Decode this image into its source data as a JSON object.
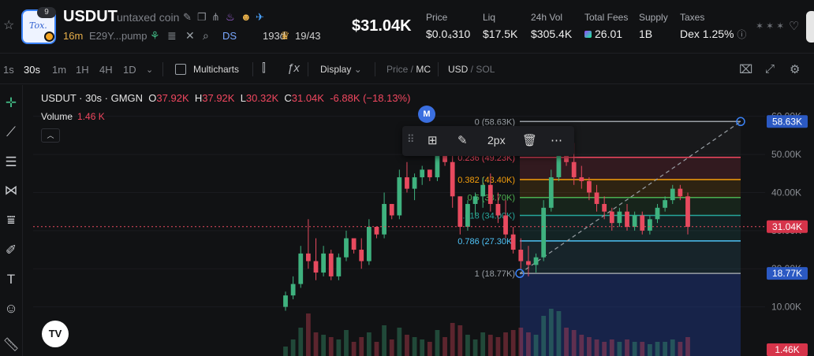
{
  "header": {
    "token_symbol": "USDUT",
    "token_name": "untaxed coin",
    "logo_text": "Tox.",
    "logo_badge": "9",
    "age": "16m",
    "address": "E29Y...pump",
    "ds_label": "DS",
    "ds_value": "193d",
    "holders": "19/43",
    "price": "$31.04K",
    "stats": [
      {
        "label": "Price",
        "value": "$0.0₄310"
      },
      {
        "label": "Liq",
        "value": "$17.5K"
      },
      {
        "label": "24h Vol",
        "value": "$305.4K"
      },
      {
        "label": "Total Fees",
        "value": "26.01"
      },
      {
        "label": "Supply",
        "value": "1B"
      },
      {
        "label": "Taxes",
        "value": "Dex 1.25%"
      }
    ]
  },
  "toolbar": {
    "timeframes": [
      "1s",
      "30s",
      "1m",
      "1H",
      "4H",
      "1D"
    ],
    "active_timeframe": "30s",
    "multicharts": "Multicharts",
    "display": "Display",
    "price_label": "Price",
    "mc_label": "MC",
    "usd_label": "USD",
    "sol_label": "SOL"
  },
  "legend": {
    "title": "USDUT · 30s · GMGN",
    "o_label": "O",
    "o_value": "37.92K",
    "h_label": "H",
    "h_value": "37.92K",
    "l_label": "L",
    "l_value": "30.32K",
    "c_label": "C",
    "c_value": "31.04K",
    "change": "-6.88K (−18.13%)",
    "volume_label": "Volume",
    "volume_value": "1.46 K"
  },
  "float_bar": {
    "width_label": "2px"
  },
  "marker": "M",
  "chart_data": {
    "type": "candlestick",
    "price_axis_ticks": [
      "60.00K",
      "50.00K",
      "40.00K",
      "30.00K",
      "20.00K",
      "10.00K"
    ],
    "current_price_tag": "31.04K",
    "top_tag": "58.63K",
    "bottom_tag": "18.77K",
    "volume_tag": "1.46K",
    "fib_levels": [
      {
        "label": "0 (58.63K)",
        "ratio": 0,
        "price": 58.63,
        "color": "#9aa0a6"
      },
      {
        "label": "0.236 (49.23K)",
        "ratio": 0.236,
        "price": 49.23,
        "color": "#f0475f"
      },
      {
        "label": "0.382 (43.40K)",
        "ratio": 0.382,
        "price": 43.4,
        "color": "#f59e0b"
      },
      {
        "label": "0.5 (38.70K)",
        "ratio": 0.5,
        "price": 38.7,
        "color": "#4caf50"
      },
      {
        "label": "0.618 (34.00K)",
        "ratio": 0.618,
        "price": 34.0,
        "color": "#26a69a"
      },
      {
        "label": "0.786 (27.30K)",
        "ratio": 0.786,
        "price": 27.3,
        "color": "#4fc3f7"
      },
      {
        "label": "1 (18.77K)",
        "ratio": 1,
        "price": 18.77,
        "color": "#9aa0a6"
      }
    ],
    "candles": [
      [
        10,
        14,
        9,
        13
      ],
      [
        13,
        18,
        12,
        16
      ],
      [
        16,
        26,
        15,
        24
      ],
      [
        24,
        33,
        20,
        22
      ],
      [
        22,
        28,
        17,
        19
      ],
      [
        19,
        26,
        18,
        24
      ],
      [
        24,
        25,
        17,
        18
      ],
      [
        18,
        24,
        17,
        23
      ],
      [
        23,
        30,
        22,
        28
      ],
      [
        28,
        27,
        24,
        25
      ],
      [
        25,
        28,
        20,
        22
      ],
      [
        22,
        33,
        21,
        31
      ],
      [
        31,
        29,
        28,
        29
      ],
      [
        29,
        40,
        28,
        37
      ],
      [
        37,
        36,
        33,
        34
      ],
      [
        34,
        46,
        33,
        44
      ],
      [
        44,
        48,
        40,
        41
      ],
      [
        41,
        45,
        38,
        44
      ],
      [
        44,
        47,
        42,
        46
      ],
      [
        46,
        44,
        43,
        44
      ],
      [
        44,
        52,
        43,
        50
      ],
      [
        50,
        53,
        47,
        48
      ],
      [
        48,
        51,
        36,
        39
      ],
      [
        39,
        38,
        29,
        31
      ],
      [
        31,
        38,
        30,
        37
      ],
      [
        37,
        40,
        34,
        39
      ],
      [
        39,
        44,
        36,
        42
      ],
      [
        42,
        45,
        35,
        37
      ],
      [
        37,
        40,
        32,
        34
      ],
      [
        34,
        38,
        28,
        29
      ],
      [
        29,
        31,
        24,
        25
      ],
      [
        25,
        28,
        20,
        22
      ],
      [
        22,
        26,
        18,
        21
      ],
      [
        21,
        24,
        19,
        23
      ],
      [
        23,
        38,
        22,
        36
      ],
      [
        36,
        46,
        35,
        44
      ],
      [
        44,
        55,
        43,
        53
      ],
      [
        53,
        50,
        47,
        48
      ],
      [
        48,
        53,
        42,
        44
      ],
      [
        44,
        47,
        41,
        43
      ],
      [
        43,
        44,
        38,
        40
      ],
      [
        40,
        42,
        35,
        37
      ],
      [
        37,
        39,
        33,
        35
      ],
      [
        35,
        36,
        30,
        32
      ],
      [
        32,
        36,
        31,
        35
      ],
      [
        35,
        37,
        30,
        31
      ],
      [
        31,
        35,
        30,
        34
      ],
      [
        34,
        35,
        29,
        30
      ],
      [
        30,
        34,
        29,
        33
      ],
      [
        33,
        37,
        32,
        36
      ],
      [
        36,
        39,
        35,
        38
      ],
      [
        38,
        42,
        37,
        41
      ],
      [
        41,
        42,
        38,
        39
      ],
      [
        39,
        40,
        29,
        31
      ]
    ],
    "volumes": [
      0.2,
      0.35,
      0.6,
      0.9,
      0.5,
      0.45,
      0.4,
      0.35,
      0.55,
      0.3,
      0.4,
      0.5,
      0.3,
      0.65,
      0.35,
      0.6,
      0.45,
      0.4,
      0.35,
      0.3,
      0.55,
      0.4,
      0.7,
      0.65,
      0.45,
      0.35,
      0.5,
      0.45,
      0.4,
      0.5,
      0.55,
      0.6,
      0.5,
      0.45,
      0.85,
      1.0,
      0.95,
      0.6,
      0.55,
      0.45,
      0.4,
      0.35,
      0.3,
      0.35,
      0.3,
      0.35,
      0.3,
      0.3,
      0.25,
      0.3,
      0.3,
      0.35,
      0.3,
      0.4
    ],
    "colors": {
      "up": "#3fb27f",
      "down": "#e84a5f",
      "fib_box": "#1e3a8a"
    }
  }
}
